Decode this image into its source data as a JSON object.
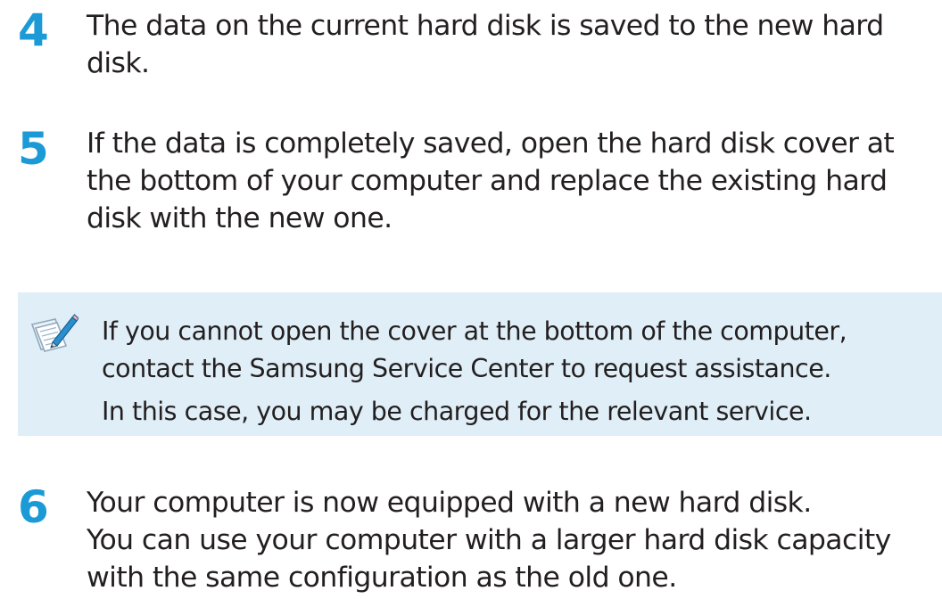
{
  "steps": [
    {
      "number": "4",
      "lines": [
        "The data on the current hard disk is saved to the new hard",
        "disk."
      ]
    },
    {
      "number": "5",
      "lines": [
        "If the data is completely saved, open the hard disk cover at",
        "the bottom of your computer and replace the existing hard",
        "disk with the new one."
      ]
    },
    {
      "number": "6",
      "lines": [
        "Your computer is now equipped with a new hard disk.",
        "You can use your computer with a larger hard disk capacity",
        "with the same configuration as the old one."
      ]
    }
  ],
  "note": {
    "icon": "note-pencil-icon",
    "lines": [
      "If you cannot open the cover at the bottom of the computer,",
      "contact the Samsung Service Center to request assistance.",
      "In this case, you may be charged for the relevant service."
    ]
  },
  "colors": {
    "step_number": "#1b9ad6",
    "note_background": "#dfeef7",
    "text": "#231f20"
  }
}
